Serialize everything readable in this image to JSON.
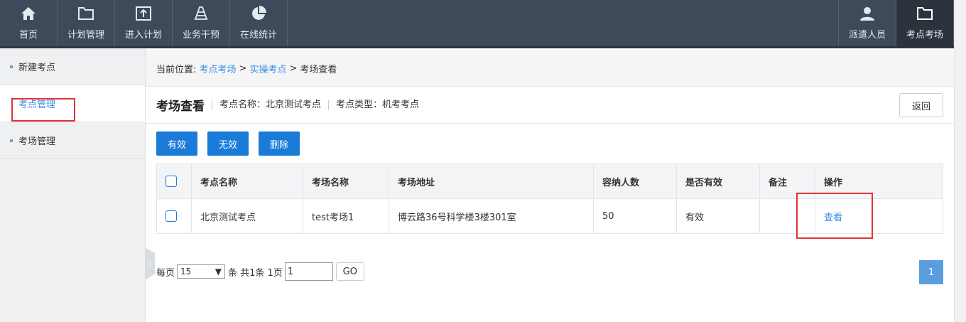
{
  "topnav": {
    "items": [
      {
        "label": "首页",
        "icon": "home-icon"
      },
      {
        "label": "计划管理",
        "icon": "folder-icon"
      },
      {
        "label": "进入计划",
        "icon": "upload-icon"
      },
      {
        "label": "业务干预",
        "icon": "cone-icon"
      },
      {
        "label": "在线统计",
        "icon": "pie-chart-icon"
      }
    ],
    "right_items": [
      {
        "label": "派遣人员",
        "icon": "user-icon"
      },
      {
        "label": "考点考场",
        "icon": "folder-icon"
      }
    ]
  },
  "sidebar": {
    "items": [
      {
        "label": "新建考点"
      },
      {
        "label": "考点管理"
      },
      {
        "label": "考场管理"
      }
    ]
  },
  "breadcrumb": {
    "prefix": "当前位置:",
    "crumbs": [
      "考点考场",
      "实操考点",
      "考场查看"
    ],
    "sep": ">"
  },
  "header": {
    "title": "考场查看",
    "site_name": "考点名称：北京测试考点",
    "site_type": "考点类型：机考考点",
    "back_label": "返回"
  },
  "actions": {
    "valid": "有效",
    "invalid": "无效",
    "delete": "删除"
  },
  "table": {
    "columns": [
      "考点名称",
      "考场名称",
      "考场地址",
      "容纳人数",
      "是否有效",
      "备注",
      "操作"
    ],
    "rows": [
      {
        "site": "北京测试考点",
        "room": "test考场1",
        "address": "博云路36号科学楼3楼301室",
        "capacity": "50",
        "valid": "有效",
        "note": "",
        "op": "查看"
      }
    ]
  },
  "pager": {
    "per_page_label": "每页",
    "per_page_value": "15",
    "summary": "条 共1条 1页",
    "page_input": "1",
    "go_label": "GO",
    "current_page": "1"
  },
  "colors": {
    "nav_bg": "#3e4a59",
    "primary": "#1a7bd8",
    "link": "#3a8ee6",
    "highlight": "#e03535"
  }
}
